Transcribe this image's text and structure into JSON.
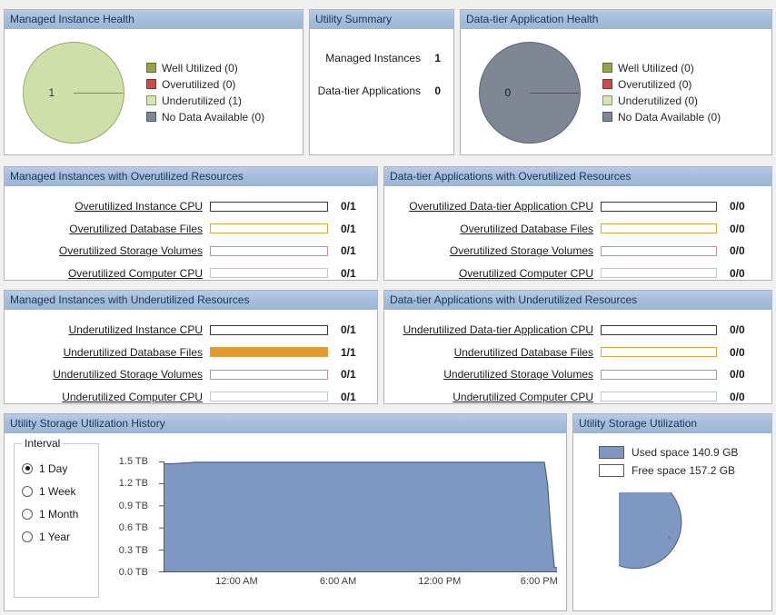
{
  "theme": {
    "header_bg": "#a5bcda",
    "header_text": "#17375e",
    "page_bg": "#f0f0f0",
    "panel_border": "#b4b4b4",
    "well_utilized": "#94a64b",
    "overutilized": "#cc4c4c",
    "underutilized": "#cfdfa9",
    "no_data": "#7f8694",
    "orange_fill": "#e8972e",
    "orange_border": "#d9a441",
    "rose_border": "#c4909a",
    "teal_border": "#b9cdd3",
    "dark_border": "#3a3a3a",
    "area_fill": "#7e97c3",
    "area_line": "#4a5f8a",
    "used_space": "#7e97c3",
    "free_space": "#ffffff"
  },
  "managed_instance_health": {
    "title": "Managed Instance Health",
    "pie": {
      "center_label": "1",
      "fill": "#cfdfa9",
      "stroke": "#97a86f"
    },
    "legend": [
      {
        "label": "Well Utilized (0)",
        "color": "#94a64b"
      },
      {
        "label": "Overutilized (0)",
        "color": "#cc4c4c"
      },
      {
        "label": "Underutilized (1)",
        "color": "#d5e4b0"
      },
      {
        "label": "No Data Available (0)",
        "color": "#7f8694"
      }
    ]
  },
  "utility_summary": {
    "title": "Utility Summary",
    "rows": [
      {
        "label": "Managed Instances",
        "value": "1"
      },
      {
        "label": "Data-tier Applications",
        "value": "0"
      }
    ]
  },
  "data_tier_application_health": {
    "title": "Data-tier Application Health",
    "pie": {
      "center_label": "0",
      "fill": "#7f8694",
      "stroke": "#5d6473"
    },
    "legend": [
      {
        "label": "Well Utilized (0)",
        "color": "#94a64b"
      },
      {
        "label": "Overutilized (0)",
        "color": "#cc4c4c"
      },
      {
        "label": "Underutilized (0)",
        "color": "#d5e4b0"
      },
      {
        "label": "No Data Available (0)",
        "color": "#7f8694"
      }
    ]
  },
  "managed_instances_overutilized": {
    "title": "Managed Instances with Overutilized Resources",
    "rows": [
      {
        "label": "Overutilized Instance CPU",
        "count": "0/1",
        "percent": 0,
        "border": "#3a3a3a",
        "fill": "#e8972e"
      },
      {
        "label": "Overutilized Database Files",
        "count": "0/1",
        "percent": 0,
        "border": "#d9a441",
        "fill": "#e8972e"
      },
      {
        "label": "Overutilized Storage Volumes",
        "count": "0/1",
        "percent": 0,
        "border": "#c4909a",
        "fill": "#cc4c4c"
      },
      {
        "label": "Overutilized Computer CPU",
        "count": "0/1",
        "percent": 0,
        "border": "#b9cdd3",
        "fill": "#7e97c3"
      }
    ]
  },
  "data_tier_overutilized": {
    "title": "Data-tier Applications with Overutilized Resources",
    "rows": [
      {
        "label": "Overutilized Data-tier Application CPU",
        "count": "0/0",
        "percent": 0,
        "border": "#3a3a3a",
        "fill": "#e8972e"
      },
      {
        "label": "Overutilized Database Files",
        "count": "0/0",
        "percent": 0,
        "border": "#d9a441",
        "fill": "#e8972e"
      },
      {
        "label": "Overutilized Storage Volumes",
        "count": "0/0",
        "percent": 0,
        "border": "#c4909a",
        "fill": "#cc4c4c"
      },
      {
        "label": "Overutilized Computer CPU",
        "count": "0/0",
        "percent": 0,
        "border": "#b9cdd3",
        "fill": "#7e97c3"
      }
    ]
  },
  "managed_instances_underutilized": {
    "title": "Managed Instances with Underutilized Resources",
    "rows": [
      {
        "label": "Underutilized Instance CPU",
        "count": "0/1",
        "percent": 0,
        "border": "#3a3a3a",
        "fill": "#e8972e"
      },
      {
        "label": "Underutilized Database Files",
        "count": "1/1",
        "percent": 100,
        "border": "#d9a441",
        "fill": "#e8972e"
      },
      {
        "label": "Underutilized Storage Volumes",
        "count": "0/1",
        "percent": 0,
        "border": "#c4909a",
        "fill": "#cc4c4c"
      },
      {
        "label": "Underutilized Computer CPU",
        "count": "0/1",
        "percent": 0,
        "border": "#b9cdd3",
        "fill": "#7e97c3"
      }
    ]
  },
  "data_tier_underutilized": {
    "title": "Data-tier Applications with Underutilized Resources",
    "rows": [
      {
        "label": "Underutilized Data-tier Application CPU",
        "count": "0/0",
        "percent": 0,
        "border": "#3a3a3a",
        "fill": "#e8972e"
      },
      {
        "label": "Underutilized Database Files",
        "count": "0/0",
        "percent": 0,
        "border": "#d9a441",
        "fill": "#e8972e"
      },
      {
        "label": "Underutilized Storage Volumes",
        "count": "0/0",
        "percent": 0,
        "border": "#c4909a",
        "fill": "#cc4c4c"
      },
      {
        "label": "Underutilized Computer CPU",
        "count": "0/0",
        "percent": 0,
        "border": "#b9cdd3",
        "fill": "#7e97c3"
      }
    ]
  },
  "storage_history": {
    "title": "Utility Storage Utilization History",
    "interval_legend": "Interval",
    "intervals": [
      {
        "label": "1 Day",
        "selected": true
      },
      {
        "label": "1 Week",
        "selected": false
      },
      {
        "label": "1 Month",
        "selected": false
      },
      {
        "label": "1 Year",
        "selected": false
      }
    ]
  },
  "storage_utilization": {
    "title": "Utility Storage Utilization",
    "legend": [
      {
        "label": "Used space 140.9 GB",
        "color": "#7e97c3"
      },
      {
        "label": "Free space 157.2 GB",
        "color": "#ffffff"
      }
    ],
    "slices": [
      {
        "name": "Used space",
        "value": 140.9,
        "unit": "GB",
        "color": "#7e97c3"
      },
      {
        "name": "Free space",
        "value": 157.2,
        "unit": "GB",
        "color": "#ffffff"
      }
    ]
  },
  "chart_data": [
    {
      "type": "area",
      "title": "Utility Storage Utilization History",
      "xlabel": "",
      "ylabel": "",
      "ylim": [
        0.0,
        1.5
      ],
      "yticks": [
        "0.0 TB",
        "0.3 TB",
        "0.6 TB",
        "0.9 TB",
        "1.2 TB",
        "1.5 TB"
      ],
      "ytick_values": [
        0.0,
        0.3,
        0.6,
        0.9,
        1.2,
        1.5
      ],
      "xticks": [
        "12:00 AM",
        "6:00 AM",
        "12:00 PM",
        "6:00 PM"
      ],
      "xtick_positions": [
        0.195,
        0.45,
        0.705,
        0.955
      ],
      "grid": false,
      "legend": "none",
      "x": [
        0,
        0.02,
        0.05,
        0.08,
        0.12,
        0.2,
        0.3,
        0.4,
        0.5,
        0.6,
        0.7,
        0.8,
        0.88,
        0.93,
        0.955,
        0.963,
        0.97,
        0.98,
        1.0
      ],
      "values": [
        1.47,
        1.47,
        1.48,
        1.49,
        1.49,
        1.49,
        1.49,
        1.49,
        1.49,
        1.49,
        1.49,
        1.49,
        1.49,
        1.49,
        1.49,
        1.2,
        0.6,
        0.07,
        0.06
      ],
      "units": "TB"
    },
    {
      "type": "pie",
      "title": "Utility Storage Utilization",
      "labels": [
        "Used space",
        "Free space"
      ],
      "values": [
        140.9,
        157.2
      ],
      "units": "GB",
      "colors": [
        "#7e97c3",
        "#ffffff"
      ],
      "exploded": [
        "Free space"
      ],
      "legend": "top"
    },
    {
      "type": "pie",
      "title": "Managed Instance Health",
      "labels": [
        "Well Utilized",
        "Overutilized",
        "Underutilized",
        "No Data Available"
      ],
      "values": [
        0,
        0,
        1,
        0
      ],
      "colors": [
        "#94a64b",
        "#cc4c4c",
        "#cfdfa9",
        "#7f8694"
      ],
      "legend": "right"
    },
    {
      "type": "pie",
      "title": "Data-tier Application Health",
      "labels": [
        "Well Utilized",
        "Overutilized",
        "Underutilized",
        "No Data Available"
      ],
      "values": [
        0,
        0,
        0,
        0
      ],
      "colors": [
        "#94a64b",
        "#cc4c4c",
        "#cfdfa9",
        "#7f8694"
      ],
      "legend": "right"
    }
  ]
}
